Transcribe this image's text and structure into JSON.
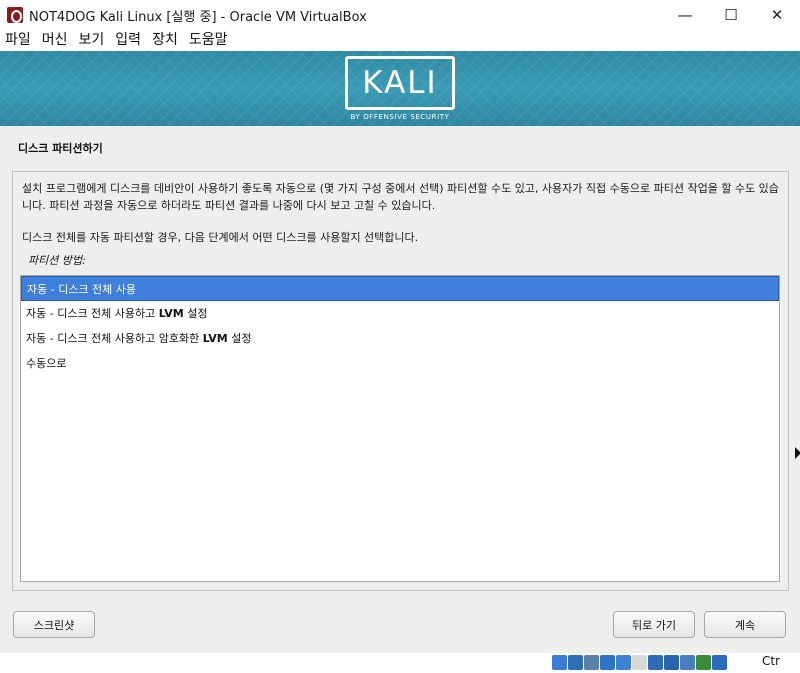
{
  "window": {
    "title": "NOT4DOG Kali Linux [실행 중] - Oracle VM VirtualBox",
    "minimize": "—",
    "maximize": "☐",
    "close": "✕"
  },
  "menu": [
    "파일",
    "머신",
    "보기",
    "입력",
    "장치",
    "도움말"
  ],
  "banner": {
    "logo": "KALI",
    "tagline": "BY OFFENSIVE SECURITY"
  },
  "installer": {
    "title": "디스크 파티션하기",
    "description": "설치 프로그램에게 디스크를 데비안이 사용하기 좋도록 자동으로 (몇 가지 구성 중에서 선택) 파티션할 수도 있고, 사용자가 직접 수동으로 파티션 작업을 할 수도 있습니다. 파티션 과정을 자동으로 하더라도 파티션 결과를 나중에 다시 보고 고칠 수 있습니다.",
    "description2": "디스크 전체를 자동 파티션할 경우, 다음 단계에서 어떤 디스크를 사용할지 선택합니다.",
    "method_label": "파티션 방법:",
    "options": [
      {
        "prefix": "자동 - 디스크 전체 사용",
        "bold": "",
        "suffix": ""
      },
      {
        "prefix": "자동 - 디스크 전체 사용하고 ",
        "bold": "LVM",
        "suffix": " 설정"
      },
      {
        "prefix": "자동 - 디스크 전체 사용하고 암호화한 ",
        "bold": "LVM",
        "suffix": " 설정"
      },
      {
        "prefix": "수동으로",
        "bold": "",
        "suffix": ""
      }
    ],
    "selected_index": 0,
    "buttons": {
      "screenshot": "스크린샷",
      "back": "뒤로 가기",
      "continue": "계속"
    }
  },
  "statusbar": {
    "host_key": "Ctr",
    "icons": [
      {
        "name": "hard-disk-icon",
        "color": "#3a7bd5"
      },
      {
        "name": "optical-drive-icon",
        "color": "#2f6fb8"
      },
      {
        "name": "audio-icon",
        "color": "#5a7fa8"
      },
      {
        "name": "network-icon",
        "color": "#2d74c7"
      },
      {
        "name": "usb-icon",
        "color": "#3b83d1"
      },
      {
        "name": "shared-folders-icon",
        "color": "#d8d8d8"
      },
      {
        "name": "display-icon",
        "color": "#2e6db5"
      },
      {
        "name": "recording-icon",
        "color": "#2a66b0"
      },
      {
        "name": "cpu-icon",
        "color": "#4a7fbf"
      },
      {
        "name": "virtualization-icon",
        "color": "#3a8a3a"
      },
      {
        "name": "mouse-integration-icon",
        "color": "#2c6cc0"
      }
    ]
  }
}
